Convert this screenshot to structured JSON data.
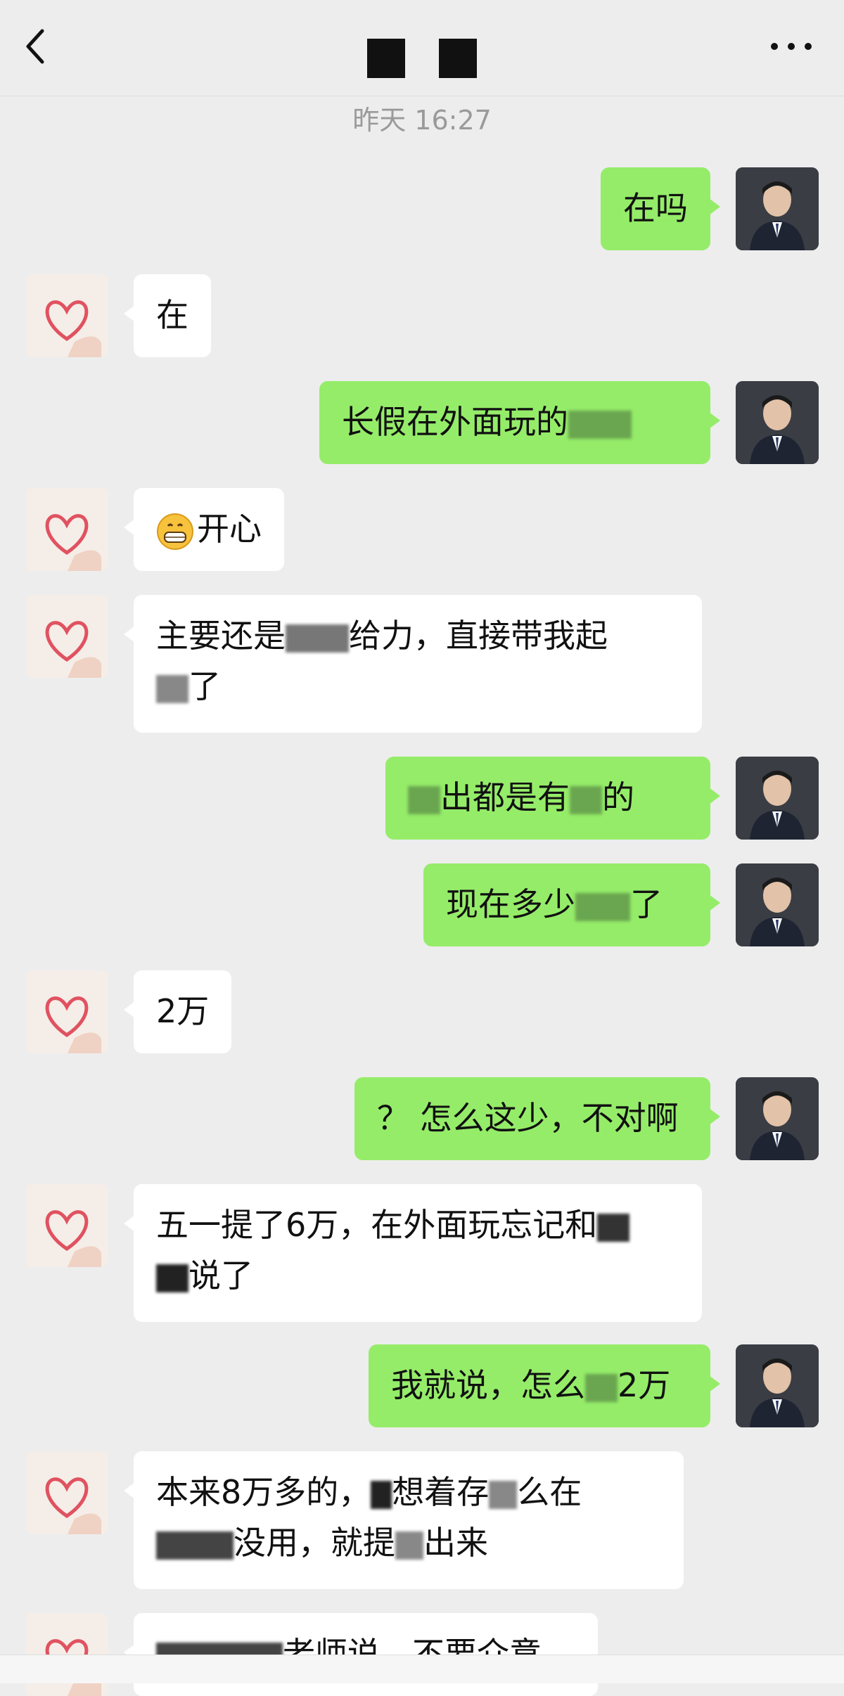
{
  "header": {
    "back_icon": "chevron-left-icon",
    "more_icon": "more-horizontal-icon"
  },
  "timestamp": "昨天 16:27",
  "messages": [
    {
      "side": "me",
      "text": "在吗"
    },
    {
      "side": "her",
      "text": "在"
    },
    {
      "side": "me",
      "text": "长假在外面玩的"
    },
    {
      "side": "her",
      "text": "开心",
      "emoji": "grinning-face-emoji"
    },
    {
      "side": "her",
      "line1": "主要还是",
      "line1b": "给力，直接带我起",
      "line2": "了"
    },
    {
      "side": "me",
      "text_a": "出都是有",
      "text_b": "的"
    },
    {
      "side": "me",
      "text_a": "现在多少",
      "text_b": "了"
    },
    {
      "side": "her",
      "text": "2万"
    },
    {
      "side": "me",
      "text": "？ 怎么这少，不对啊"
    },
    {
      "side": "her",
      "line1": "五一提",
      "line1b": "了6万，在外面玩忘记和",
      "line2": "说了"
    },
    {
      "side": "me",
      "text_a": "我就说，怎么",
      "text_b": "2万"
    },
    {
      "side": "her",
      "line1": "本来8万多的，",
      "line1b": "想着存",
      "line1c": "么在",
      "line2a": "没用，就提",
      "line2b": "出来"
    },
    {
      "side": "her",
      "line1": "老师说，不要介意"
    }
  ],
  "colors": {
    "my_bubble": "#95ec69",
    "her_bubble": "#ffffff",
    "background": "#ededed"
  }
}
